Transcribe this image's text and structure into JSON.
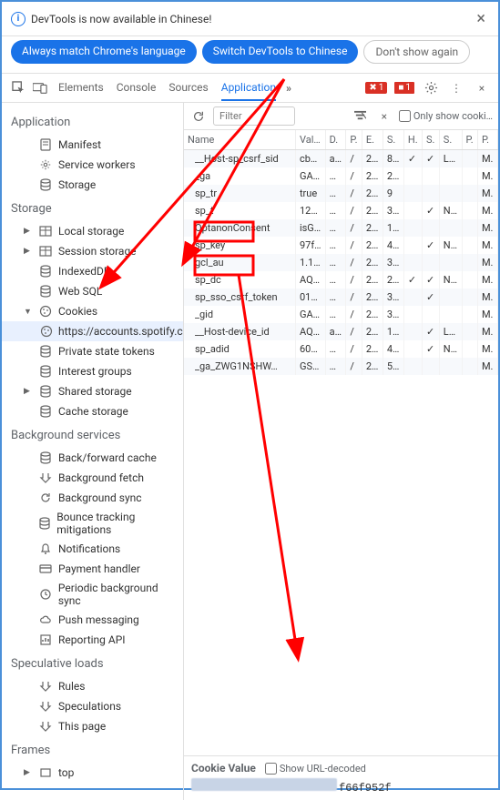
{
  "banner": {
    "text": "DevTools is now available in Chinese!",
    "btn_match": "Always match Chrome's language",
    "btn_switch": "Switch DevTools to Chinese",
    "btn_dont": "Don't show again"
  },
  "toolbar": {
    "tabs": [
      "Elements",
      "Console",
      "Sources",
      "Application"
    ],
    "active_tab": "Application",
    "more": "»",
    "err1_count": "1",
    "err2_count": "1"
  },
  "sidebar": {
    "app_section": "Application",
    "app_items": [
      {
        "label": "Manifest",
        "icon": "manifest"
      },
      {
        "label": "Service workers",
        "icon": "gear"
      },
      {
        "label": "Storage",
        "icon": "db"
      }
    ],
    "storage_section": "Storage",
    "storage_items": [
      {
        "label": "Local storage",
        "icon": "grid",
        "exp": true
      },
      {
        "label": "Session storage",
        "icon": "grid",
        "exp": true
      },
      {
        "label": "IndexedDB",
        "icon": "db"
      },
      {
        "label": "Web SQL",
        "icon": "db"
      },
      {
        "label": "Cookies",
        "icon": "cookie",
        "exp": true,
        "open": true
      },
      {
        "label": "https://accounts.spotify.co",
        "icon": "cookie",
        "indent": true,
        "sel": true
      },
      {
        "label": "Private state tokens",
        "icon": "db"
      },
      {
        "label": "Interest groups",
        "icon": "db"
      },
      {
        "label": "Shared storage",
        "icon": "db",
        "exp": true
      },
      {
        "label": "Cache storage",
        "icon": "db"
      }
    ],
    "bg_section": "Background services",
    "bg_items": [
      {
        "label": "Back/forward cache",
        "icon": "db"
      },
      {
        "label": "Background fetch",
        "icon": "fetch"
      },
      {
        "label": "Background sync",
        "icon": "sync"
      },
      {
        "label": "Bounce tracking mitigations",
        "icon": "db"
      },
      {
        "label": "Notifications",
        "icon": "bell"
      },
      {
        "label": "Payment handler",
        "icon": "card"
      },
      {
        "label": "Periodic background sync",
        "icon": "clock"
      },
      {
        "label": "Push messaging",
        "icon": "cloud"
      },
      {
        "label": "Reporting API",
        "icon": "report"
      }
    ],
    "spec_section": "Speculative loads",
    "spec_items": [
      {
        "label": "Rules",
        "icon": "fetch"
      },
      {
        "label": "Speculations",
        "icon": "fetch"
      },
      {
        "label": "This page",
        "icon": "fetch"
      }
    ],
    "frames_section": "Frames",
    "frames_items": [
      {
        "label": "top",
        "icon": "frame",
        "exp": true
      }
    ]
  },
  "controls": {
    "filter_placeholder": "Filter",
    "only_cookies": "Only show cooki…"
  },
  "table": {
    "headers": [
      "Name",
      "Val…",
      "D.",
      "P.",
      "E.",
      "S.",
      "H.",
      "S.",
      "S.",
      "P.",
      "P."
    ],
    "rows": [
      {
        "name": "__Host-sp_csrf_sid",
        "v": "cb…",
        "d": "a…",
        "p": "/",
        "e": "2…",
        "sz": "8…",
        "h": "✓",
        "s": "✓",
        "ss": "L…",
        "pr": "",
        "pk": "M."
      },
      {
        "name": "_ga",
        "v": "GA…",
        "d": "…",
        "p": "/",
        "e": "2…",
        "sz": "2…",
        "h": "",
        "s": "",
        "ss": "",
        "pr": "",
        "pk": "M."
      },
      {
        "name": "sp_tr",
        "v": "true",
        "d": "…",
        "p": "/",
        "e": "2…",
        "sz": "9",
        "h": "",
        "s": "",
        "ss": "",
        "pr": "",
        "pk": "M."
      },
      {
        "name": "sp_t",
        "v": "12…",
        "d": "…",
        "p": "/",
        "e": "2…",
        "sz": "3…",
        "h": "",
        "s": "✓",
        "ss": "N…",
        "pr": "",
        "pk": "M."
      },
      {
        "name": "OptanonConsent",
        "v": "isG…",
        "d": "…",
        "p": "/",
        "e": "2…",
        "sz": "1…",
        "h": "",
        "s": "",
        "ss": "",
        "pr": "",
        "pk": "M."
      },
      {
        "name": "sp_key",
        "v": "97f…",
        "d": "…",
        "p": "/",
        "e": "2…",
        "sz": "4…",
        "h": "",
        "s": "✓",
        "ss": "N…",
        "pr": "",
        "pk": "M.",
        "hl": true
      },
      {
        "name": "gcl_au",
        "v": "1.1…",
        "d": "…",
        "p": "/",
        "e": "2…",
        "sz": "3…",
        "h": "",
        "s": "",
        "ss": "",
        "pr": "",
        "pk": "M."
      },
      {
        "name": "sp_dc",
        "v": "AQ…",
        "d": "…",
        "p": "/",
        "e": "2…",
        "sz": "2…",
        "h": "✓",
        "s": "✓",
        "ss": "N…",
        "pr": "",
        "pk": "M.",
        "hl": true
      },
      {
        "name": "sp_sso_csrf_token",
        "v": "01…",
        "d": "…",
        "p": "/",
        "e": "2…",
        "sz": "3…",
        "h": "",
        "s": "✓",
        "ss": "",
        "pr": "",
        "pk": "M."
      },
      {
        "name": "_gid",
        "v": "GA…",
        "d": "…",
        "p": "/",
        "e": "2…",
        "sz": "3…",
        "h": "",
        "s": "",
        "ss": "",
        "pr": "",
        "pk": "M."
      },
      {
        "name": "__Host-device_id",
        "v": "AQ…",
        "d": "a…",
        "p": "/",
        "e": "2…",
        "sz": "1…",
        "h": "",
        "s": "✓",
        "ss": "L…",
        "pr": "",
        "pk": "M."
      },
      {
        "name": "sp_adid",
        "v": "60…",
        "d": "…",
        "p": "/",
        "e": "2…",
        "sz": "4…",
        "h": "",
        "s": "✓",
        "ss": "N…",
        "pr": "",
        "pk": "M."
      },
      {
        "name": "_ga_ZWG1NSHW…",
        "v": "GS…",
        "d": "…",
        "p": "/",
        "e": "2…",
        "sz": "5…",
        "h": "",
        "s": "",
        "ss": "",
        "pr": "",
        "pk": "M."
      }
    ]
  },
  "cookie_value": {
    "title": "Cookie Value",
    "show_decoded": "Show URL-decoded",
    "tail": "f66f952f"
  }
}
